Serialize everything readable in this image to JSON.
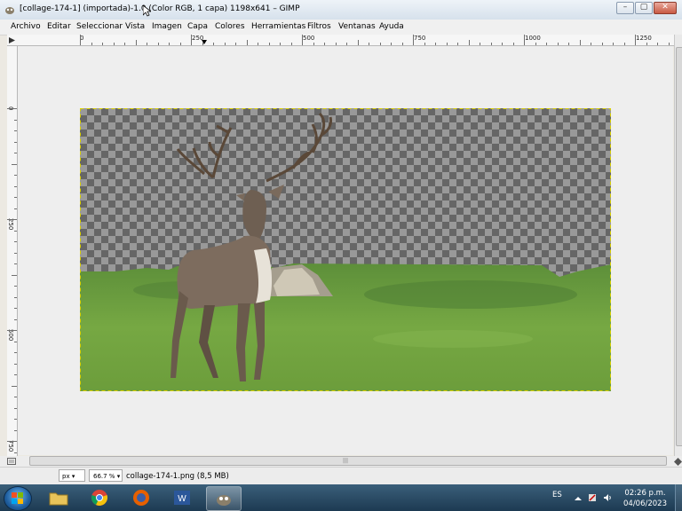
{
  "window": {
    "title": "[collage-174-1] (importada)-1.0 (Color RGB, 1 capa) 1198x641 – GIMP",
    "minimize": "–",
    "maximize": "▢",
    "close": "✕"
  },
  "menu": [
    "Archivo",
    "Editar",
    "Seleccionar",
    "Vista",
    "Imagen",
    "Capa",
    "Colores",
    "Herramientas",
    "Filtros",
    "Ventanas",
    "Ayuda"
  ],
  "ruler": {
    "h_labels": [
      "0",
      "250",
      "500",
      "750",
      "1000",
      "1250"
    ],
    "v_labels": [
      "0",
      "250",
      "500",
      "750"
    ]
  },
  "canvas": {
    "image_description_alt": "deer-collage-image"
  },
  "statusbar": {
    "unit": "px",
    "zoom": "66.7 %",
    "file_info": "collage-174-1.png (8,5 MB)"
  },
  "taskbar": {
    "language": "ES",
    "time": "02:26 p.m.",
    "date": "04/06/2023"
  },
  "colors": {
    "titlebar": "#d6e1ec",
    "taskbar": "#1d3a52",
    "canvas_bg": "#eeeeee",
    "grass": "#6a9a3a",
    "checker_dark": "#666666",
    "checker_light": "#999999"
  }
}
